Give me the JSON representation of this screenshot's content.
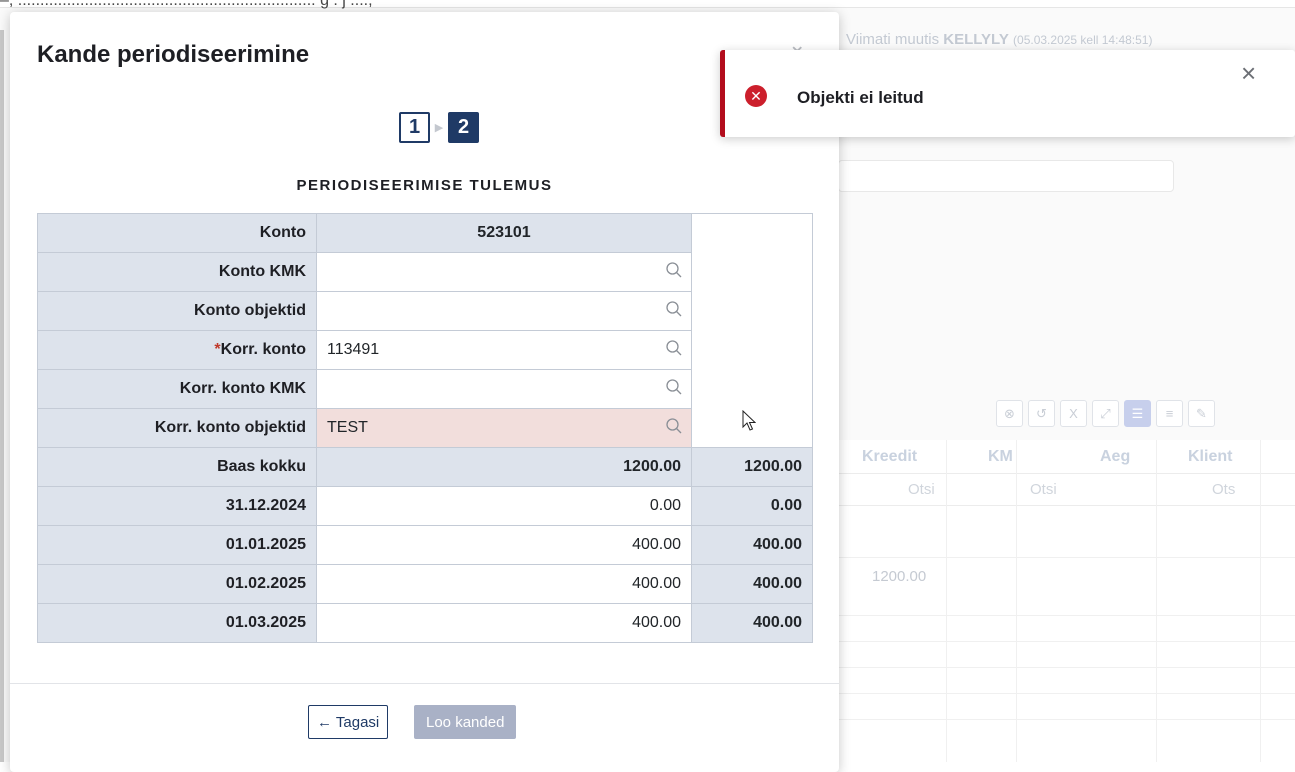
{
  "background": {
    "top_text": "–, ................................................................... g . j ....,",
    "modified_prefix": "Viimati muutis ",
    "modified_user": "KELLYLY",
    "modified_time": "(05.03.2025 kell 14:48:51)",
    "grid_headers": [
      "Kreedit",
      "KM",
      "Aeg",
      "Klient"
    ],
    "filter_placeholders": [
      "Otsi",
      "Otsi",
      "Ots"
    ],
    "row_value": "1200.00"
  },
  "modal": {
    "title": "Kande periodiseerimine",
    "steps": [
      "1",
      "2"
    ],
    "section_title": "PERIODISEERIMISE TULEMUS",
    "rows": [
      {
        "label": "Konto",
        "value": "523101"
      },
      {
        "label": "Konto KMK",
        "value": ""
      },
      {
        "label": "Konto objektid",
        "value": ""
      },
      {
        "label": "Korr. konto",
        "required_mark": "*",
        "value": "113491"
      },
      {
        "label": "Korr. konto KMK",
        "value": ""
      },
      {
        "label": "Korr. konto objektid",
        "value": "TEST"
      }
    ],
    "base_total": {
      "label": "Baas kokku",
      "value": "1200.00",
      "total": "1200.00"
    },
    "periods": [
      {
        "date": "31.12.2024",
        "amount": "0.00",
        "total": "0.00"
      },
      {
        "date": "01.01.2025",
        "amount": "400.00",
        "total": "400.00"
      },
      {
        "date": "01.02.2025",
        "amount": "400.00",
        "total": "400.00"
      },
      {
        "date": "01.03.2025",
        "amount": "400.00",
        "total": "400.00"
      }
    ],
    "back_button": "← Tagasi",
    "create_button": "Loo kanded"
  },
  "toast": {
    "message": "Objekti ei leitud",
    "type": "error"
  },
  "colors": {
    "primary": "#1f3a66",
    "error": "#cc1f2c",
    "label_bg": "#dde3ec",
    "invalid_bg": "#f2dedc"
  }
}
